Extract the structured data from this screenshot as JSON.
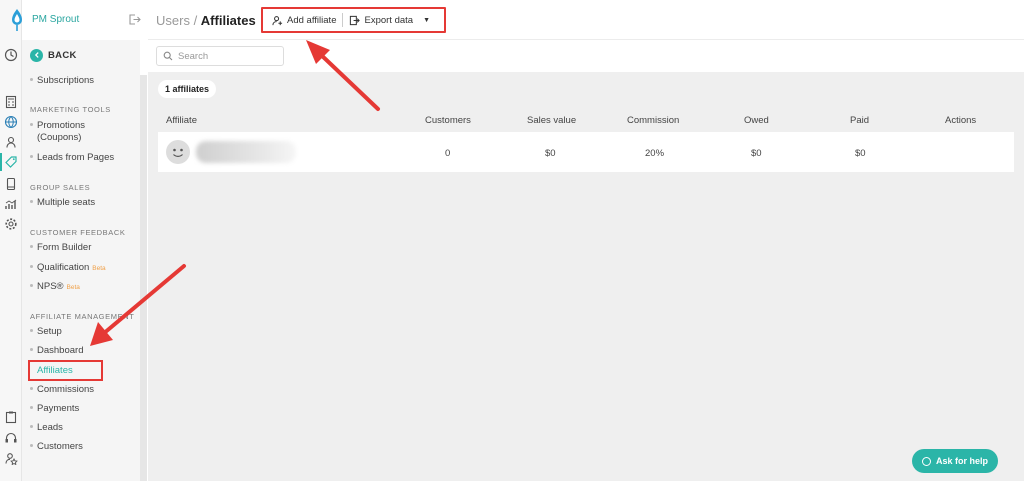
{
  "brand": {
    "name": "PM Sprout"
  },
  "menu": {
    "back_label": "BACK",
    "subscriptions": "Subscriptions",
    "marketing_heading": "MARKETING TOOLS",
    "promotions_line1": "Promotions",
    "promotions_line2": "(Coupons)",
    "leads_from_pages": "Leads from Pages",
    "group_heading": "GROUP SALES",
    "multiple_seats": "Multiple seats",
    "feedback_heading": "CUSTOMER FEEDBACK",
    "form_builder": "Form Builder",
    "qualification": "Qualification",
    "beta": "Beta",
    "nps": "NPS®",
    "affiliate_heading": "AFFILIATE MANAGEMENT",
    "setup": "Setup",
    "dashboard": "Dashboard",
    "affiliates": "Affiliates",
    "commissions": "Commissions",
    "payments": "Payments",
    "leads": "Leads",
    "customers": "Customers"
  },
  "header": {
    "breadcrumb_parent": "Users",
    "breadcrumb_sep": " / ",
    "breadcrumb_current": "Affiliates",
    "add_affiliate": "Add affiliate",
    "export_data": "Export data"
  },
  "search": {
    "placeholder": "Search"
  },
  "table": {
    "count_label": "1 affiliates",
    "columns": [
      "Affiliate",
      "Customers",
      "Sales value",
      "Commission",
      "Owed",
      "Paid",
      "Actions"
    ],
    "rows": [
      {
        "customers": "0",
        "sales_value": "$0",
        "commission": "20%",
        "owed": "$0",
        "paid": "$0"
      }
    ]
  },
  "help": {
    "label": "Ask for help"
  },
  "colors": {
    "accent": "#2bb5a8",
    "annotation": "#e53935"
  }
}
